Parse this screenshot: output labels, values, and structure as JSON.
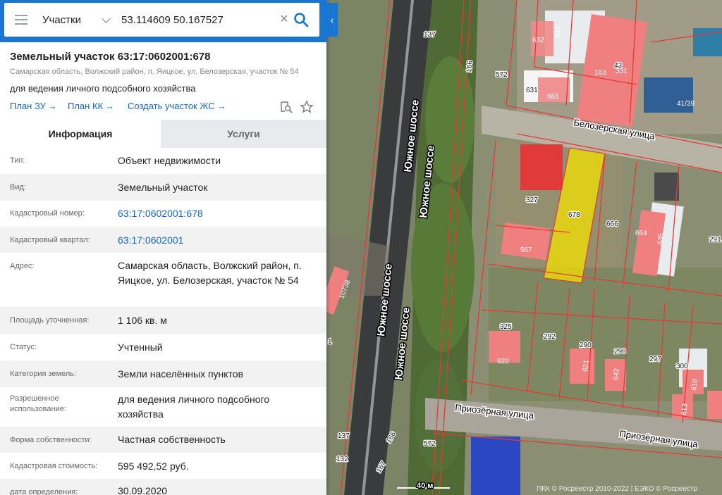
{
  "search": {
    "layer": "Участки",
    "query": "53.114609 50.167527"
  },
  "parcel": {
    "title": "Земельный участок 63:17:0602001:678",
    "address_sub": "Самарская область, Волжский район, п. Яицкое, ул. Белозерская, участок № 54",
    "purpose": "для ведения личного подсобного хозяйства"
  },
  "links": {
    "plan_zu": "План ЗУ",
    "plan_kk": "План КК",
    "create_zhs": "Создать участок ЖС",
    "arrow": "→"
  },
  "tabs": {
    "info": "Информация",
    "services": "Услуги"
  },
  "rows": [
    {
      "label": "Тип:",
      "value": "Объект недвижимости"
    },
    {
      "label": "Вид:",
      "value": "Земельный участок"
    },
    {
      "label": "Кадастровый номер:",
      "value": "63:17:0602001:678"
    },
    {
      "label": "Кадастровый квартал:",
      "value": "63:17:0602001"
    },
    {
      "label": "Адрес:",
      "value": "Самарская область, Волжский район, п. Яицкое, ул. Белозерская, участок № 54"
    },
    {
      "label": "Площадь уточненная:",
      "value": "1 106 кв. м"
    },
    {
      "label": "Статус:",
      "value": "Учтенный"
    },
    {
      "label": "Категория земель:",
      "value": "Земли населённых пунктов"
    },
    {
      "label": "Разрешенное использование:",
      "value": "для ведения личного подсобного хозяйства"
    },
    {
      "label": "Форма собственности:",
      "value": "Частная собственность"
    },
    {
      "label": "Кадастровая стоимость:",
      "value": "595 492,52 руб."
    },
    {
      "label": "дата определения:",
      "value": "30.09.2020"
    }
  ],
  "map": {
    "roads": [
      "Южное шоссе",
      "Южное шоссе",
      "Южное шоссе",
      "Южное шоссе"
    ],
    "streets": [
      "Белозерская улица",
      "Приозёрная улица",
      "Приозёрная улица"
    ],
    "plots": [
      "137",
      "166",
      "572",
      "632",
      "603",
      "163",
      "43",
      "331",
      "631",
      "681",
      "41/39",
      "327",
      "678",
      "666",
      "664",
      "635",
      "291",
      "567",
      "10738",
      "325",
      "292",
      "290",
      "298",
      "920",
      "621",
      "642",
      "297",
      "300",
      "618",
      "613",
      "137",
      "166",
      "572",
      "132",
      "167",
      "1"
    ],
    "scale": "40 м",
    "copyright": "ПКК © Росреестр 2010-2022 | ЕЭКО © Росреестр"
  },
  "colors": {
    "brand": "#1976d2",
    "link": "#1565c0",
    "parcel_outline": "#e53935",
    "selected_parcel": "#f5e000",
    "building": "#f08080"
  }
}
